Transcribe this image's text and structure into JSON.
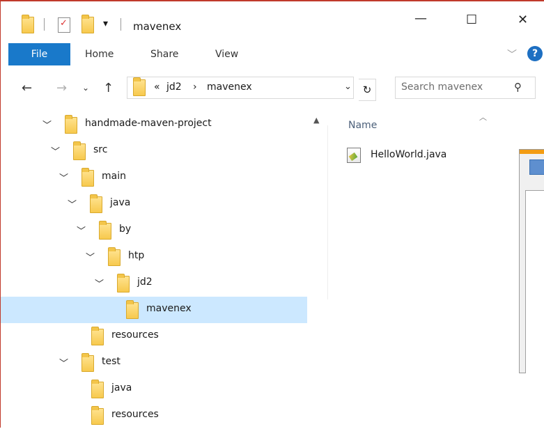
{
  "window": {
    "title": "mavenex",
    "minimize_icon": "minimize-icon",
    "maximize_icon": "maximize-icon",
    "close_icon": "close-icon"
  },
  "quick_access": {
    "dropdown_glyph": "▾"
  },
  "ribbon": {
    "tabs": [
      {
        "label": "File"
      },
      {
        "label": "Home"
      },
      {
        "label": "Share"
      },
      {
        "label": "View"
      }
    ],
    "help_label": "?"
  },
  "address_bar": {
    "overflow": "«",
    "crumbs": [
      "jd2",
      "mavenex"
    ],
    "separator": "›",
    "search_placeholder": "Search mavenex"
  },
  "nav_tree": [
    {
      "label": "handmade-maven-project",
      "expanded": true,
      "selected": false
    },
    {
      "label": "src",
      "expanded": true,
      "selected": false
    },
    {
      "label": "main",
      "expanded": true,
      "selected": false
    },
    {
      "label": "java",
      "expanded": true,
      "selected": false
    },
    {
      "label": "by",
      "expanded": true,
      "selected": false
    },
    {
      "label": "htp",
      "expanded": true,
      "selected": false
    },
    {
      "label": "jd2",
      "expanded": true,
      "selected": false
    },
    {
      "label": "mavenex",
      "expanded": false,
      "selected": true
    },
    {
      "label": "resources",
      "expanded": false,
      "selected": false
    },
    {
      "label": "test",
      "expanded": true,
      "selected": false
    },
    {
      "label": "java",
      "expanded": false,
      "selected": false
    },
    {
      "label": "resources",
      "expanded": false,
      "selected": false
    }
  ],
  "content": {
    "column_header": "Name",
    "files": [
      {
        "name": "HelloWorld.java",
        "icon": "java-file-icon"
      }
    ]
  },
  "colors": {
    "accent": "#1979ca",
    "selection": "#cce8ff",
    "folder": "#f7c94d",
    "frame": "#c0392b"
  }
}
